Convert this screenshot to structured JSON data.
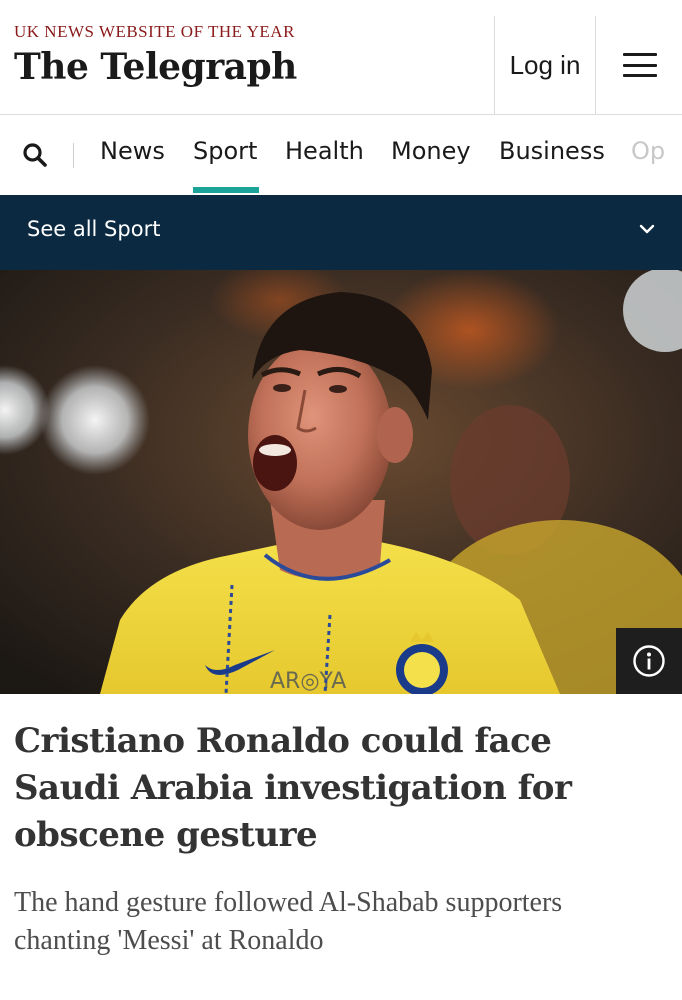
{
  "header": {
    "award": "UK NEWS WEBSITE OF THE YEAR",
    "logo": "The Telegraph",
    "login_label": "Log in",
    "menu_icon": "hamburger-menu-icon"
  },
  "nav": {
    "search_icon": "search-icon",
    "items": [
      {
        "label": "News"
      },
      {
        "label": "Sport",
        "active": true
      },
      {
        "label": "Health"
      },
      {
        "label": "Money"
      },
      {
        "label": "Business"
      },
      {
        "label": "Op"
      }
    ],
    "active_color": "#1ba39a"
  },
  "section_bar": {
    "label": "See all Sport",
    "background": "#0b2a42"
  },
  "hero": {
    "jersey_sponsor": "AR◎YA",
    "info_icon": "info-icon"
  },
  "article": {
    "headline": "Cristiano Ronaldo could face Saudi Arabia investigation for obscene gesture",
    "standfirst": "The hand gesture followed Al-Shabab supporters chanting 'Messi' at Ronaldo"
  }
}
